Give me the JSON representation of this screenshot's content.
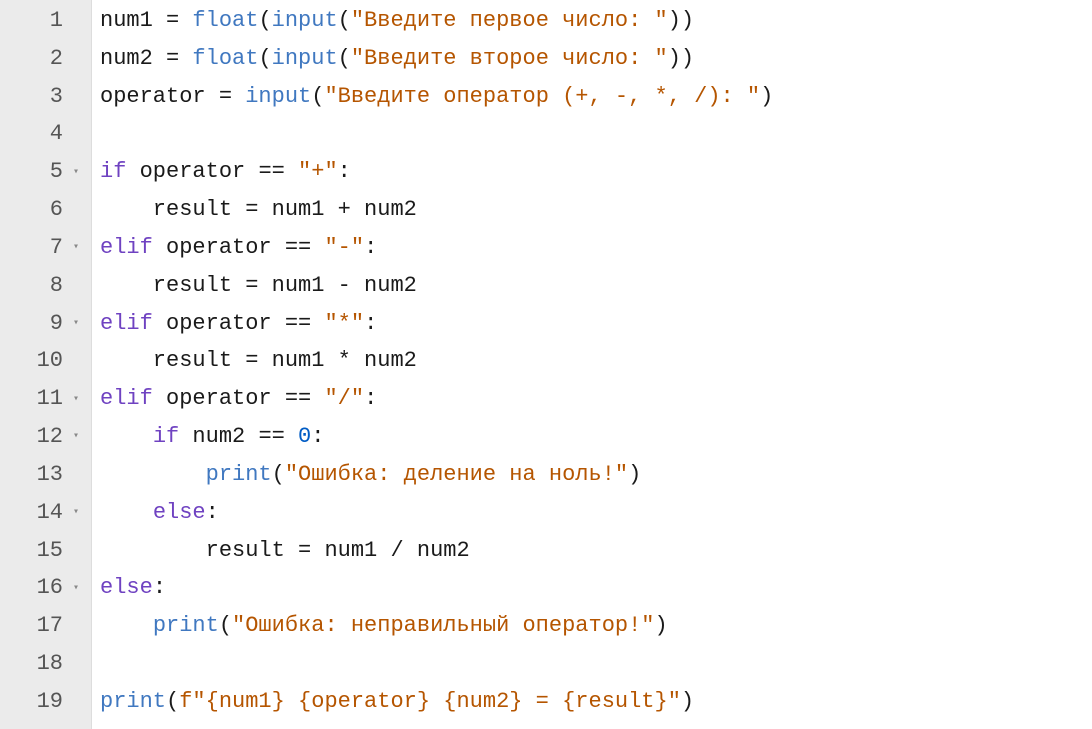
{
  "editor": {
    "gutter": [
      {
        "n": "1",
        "fold": ""
      },
      {
        "n": "2",
        "fold": ""
      },
      {
        "n": "3",
        "fold": ""
      },
      {
        "n": "4",
        "fold": ""
      },
      {
        "n": "5",
        "fold": "▾"
      },
      {
        "n": "6",
        "fold": ""
      },
      {
        "n": "7",
        "fold": "▾"
      },
      {
        "n": "8",
        "fold": ""
      },
      {
        "n": "9",
        "fold": "▾"
      },
      {
        "n": "10",
        "fold": ""
      },
      {
        "n": "11",
        "fold": "▾"
      },
      {
        "n": "12",
        "fold": "▾"
      },
      {
        "n": "13",
        "fold": ""
      },
      {
        "n": "14",
        "fold": "▾"
      },
      {
        "n": "15",
        "fold": ""
      },
      {
        "n": "16",
        "fold": "▾"
      },
      {
        "n": "17",
        "fold": ""
      },
      {
        "n": "18",
        "fold": ""
      },
      {
        "n": "19",
        "fold": ""
      }
    ],
    "lines": [
      [
        [
          "name",
          "num1"
        ],
        [
          "op",
          " = "
        ],
        [
          "fn",
          "float"
        ],
        [
          "punc",
          "("
        ],
        [
          "fn",
          "input"
        ],
        [
          "punc",
          "("
        ],
        [
          "str",
          "\"Введите первое число: \""
        ],
        [
          "punc",
          "))"
        ]
      ],
      [
        [
          "name",
          "num2"
        ],
        [
          "op",
          " = "
        ],
        [
          "fn",
          "float"
        ],
        [
          "punc",
          "("
        ],
        [
          "fn",
          "input"
        ],
        [
          "punc",
          "("
        ],
        [
          "str",
          "\"Введите второе число: \""
        ],
        [
          "punc",
          "))"
        ]
      ],
      [
        [
          "name",
          "operator"
        ],
        [
          "op",
          " = "
        ],
        [
          "fn",
          "input"
        ],
        [
          "punc",
          "("
        ],
        [
          "str",
          "\"Введите оператор (+, -, *, /): \""
        ],
        [
          "punc",
          ")"
        ]
      ],
      [],
      [
        [
          "kw",
          "if"
        ],
        [
          "name",
          " operator "
        ],
        [
          "op",
          "=="
        ],
        [
          "str",
          " \"+\""
        ],
        [
          "punc",
          ":"
        ]
      ],
      [
        [
          "name",
          "    result"
        ],
        [
          "op",
          " = "
        ],
        [
          "name",
          "num1 "
        ],
        [
          "op",
          "+"
        ],
        [
          "name",
          " num2"
        ]
      ],
      [
        [
          "kw",
          "elif"
        ],
        [
          "name",
          " operator "
        ],
        [
          "op",
          "=="
        ],
        [
          "str",
          " \"-\""
        ],
        [
          "punc",
          ":"
        ]
      ],
      [
        [
          "name",
          "    result"
        ],
        [
          "op",
          " = "
        ],
        [
          "name",
          "num1 "
        ],
        [
          "op",
          "-"
        ],
        [
          "name",
          " num2"
        ]
      ],
      [
        [
          "kw",
          "elif"
        ],
        [
          "name",
          " operator "
        ],
        [
          "op",
          "=="
        ],
        [
          "str",
          " \"*\""
        ],
        [
          "punc",
          ":"
        ]
      ],
      [
        [
          "name",
          "    result"
        ],
        [
          "op",
          " = "
        ],
        [
          "name",
          "num1 "
        ],
        [
          "op",
          "*"
        ],
        [
          "name",
          " num2"
        ]
      ],
      [
        [
          "kw",
          "elif"
        ],
        [
          "name",
          " operator "
        ],
        [
          "op",
          "=="
        ],
        [
          "str",
          " \"/\""
        ],
        [
          "punc",
          ":"
        ]
      ],
      [
        [
          "name",
          "    "
        ],
        [
          "kw",
          "if"
        ],
        [
          "name",
          " num2 "
        ],
        [
          "op",
          "=="
        ],
        [
          "num",
          " 0"
        ],
        [
          "punc",
          ":"
        ]
      ],
      [
        [
          "name",
          "        "
        ],
        [
          "fn",
          "print"
        ],
        [
          "punc",
          "("
        ],
        [
          "str",
          "\"Ошибка: деление на ноль!\""
        ],
        [
          "punc",
          ")"
        ]
      ],
      [
        [
          "name",
          "    "
        ],
        [
          "kw",
          "else"
        ],
        [
          "punc",
          ":"
        ]
      ],
      [
        [
          "name",
          "        result"
        ],
        [
          "op",
          " = "
        ],
        [
          "name",
          "num1 "
        ],
        [
          "op",
          "/"
        ],
        [
          "name",
          " num2"
        ]
      ],
      [
        [
          "kw",
          "else"
        ],
        [
          "punc",
          ":"
        ]
      ],
      [
        [
          "name",
          "    "
        ],
        [
          "fn",
          "print"
        ],
        [
          "punc",
          "("
        ],
        [
          "str",
          "\"Ошибка: неправильный оператор!\""
        ],
        [
          "punc",
          ")"
        ]
      ],
      [],
      [
        [
          "fn",
          "print"
        ],
        [
          "punc",
          "("
        ],
        [
          "str",
          "f\"{num1} {operator} {num2} = {result}\""
        ],
        [
          "punc",
          ")"
        ]
      ]
    ]
  }
}
